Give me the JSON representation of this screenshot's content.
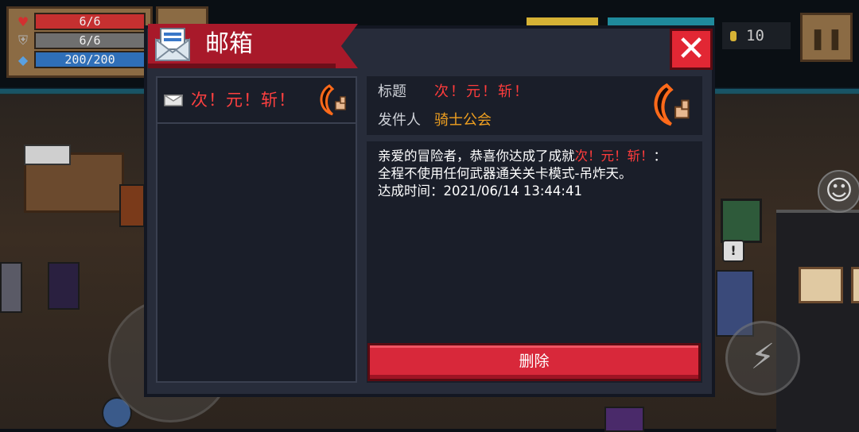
{
  "hud": {
    "hp": "6/6",
    "armor": "6/6",
    "energy": "200/200",
    "coins": "10",
    "pause_symbol": "❚❚"
  },
  "mailbox": {
    "title": "邮箱",
    "close_symbol": "✕",
    "list": [
      {
        "label": "次！元！斩！",
        "icon": "crescent-blade-icon"
      }
    ],
    "detail": {
      "subject_label": "标题",
      "subject_value": "次！元！斩！",
      "sender_label": "发件人",
      "sender_value": "骑士公会",
      "body_line1_prefix": "亲爱的冒险者，恭喜你达成了成就",
      "body_line1_highlight": "次！元！斩！",
      "body_line1_suffix": "：",
      "body_line2": "全程不使用任何武器通关关卡模式-吊炸天。",
      "body_line3": "达成时间：2021/06/14 13:44:41"
    },
    "delete_label": "删除"
  },
  "controls": {
    "emote_symbol": "☺",
    "skill_symbol": "⚡"
  },
  "colors": {
    "accent_red": "#e22734",
    "banner_red": "#a8192a",
    "highlight_text": "#ff3c3c",
    "sender_text": "#f0a020",
    "panel_bg": "#1a1e29"
  }
}
